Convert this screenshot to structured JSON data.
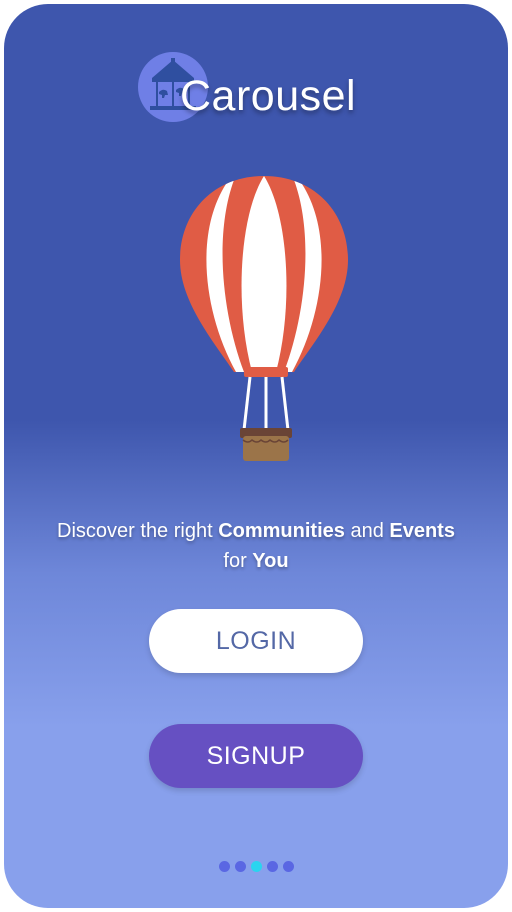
{
  "app": {
    "title": "Carousel"
  },
  "tagline": {
    "line1_part1": "Discover the right ",
    "line1_bold1": "Communities",
    "line1_part2": " and ",
    "line1_bold2": "Events",
    "line2_part1": "for ",
    "line2_bold": "You"
  },
  "buttons": {
    "login_label": "LOGIN",
    "signup_label": "SIGNUP"
  },
  "pagination": {
    "total": 5,
    "active_index": 2
  },
  "colors": {
    "background_top": "#3e56ad",
    "background_bottom": "#88a0ec",
    "balloon_stripe": "#e05c45",
    "signup_button": "#6650c2",
    "active_dot": "#2ad4ef",
    "inactive_dot": "#5a67e3"
  },
  "icons": {
    "logo": "carousel-icon",
    "hero": "hot-air-balloon-icon"
  }
}
